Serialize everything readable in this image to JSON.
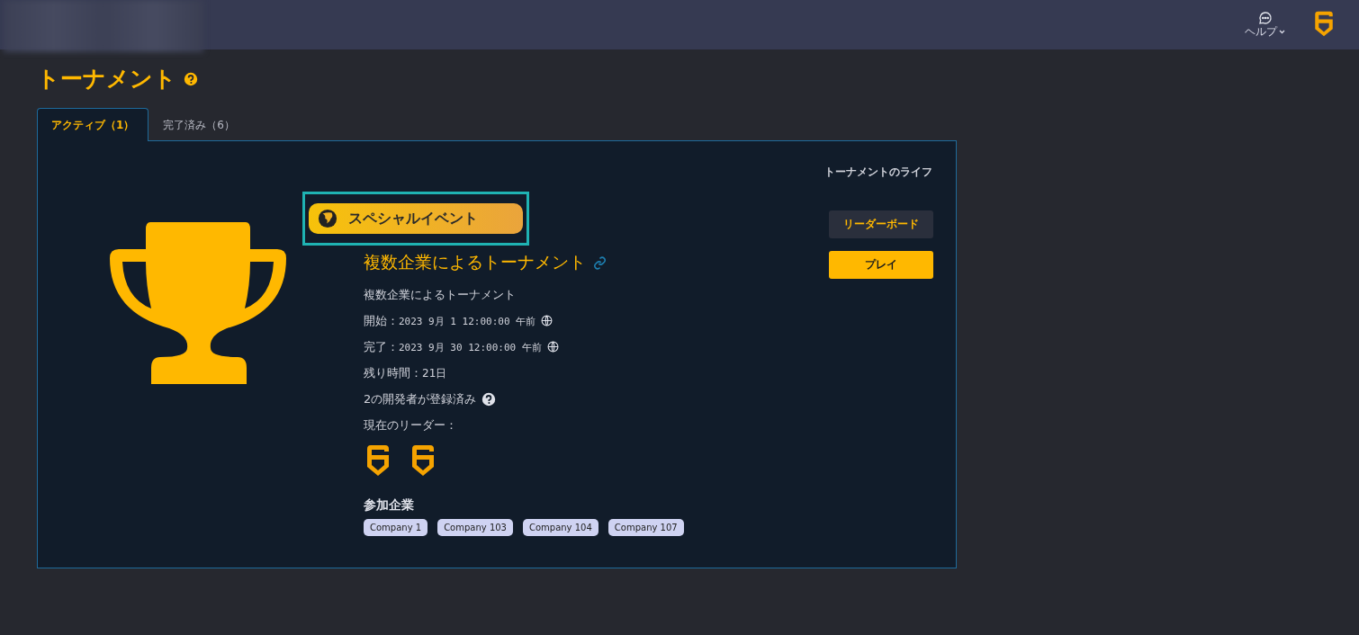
{
  "header": {
    "help_label": "ヘルプ"
  },
  "page_title": "トーナメント",
  "tabs": [
    {
      "label": "アクティブ（1）",
      "selected": true
    },
    {
      "label": "完了済み（6）",
      "selected": false
    }
  ],
  "tournament": {
    "badge": "スペシャルイベント",
    "title": "複数企業によるトーナメント",
    "description": "複数企業によるトーナメント",
    "details": [
      {
        "label": "開始：",
        "value": "2023 9月 1 12:00:00 午前",
        "kind": "date"
      },
      {
        "label": "完了：",
        "value": "2023 9月 30 12:00:00 午前",
        "kind": "date"
      },
      {
        "label": "残り時間：",
        "value": "21日",
        "kind": "plain"
      },
      {
        "label": "2の開発者が登録済み",
        "kind": "help"
      },
      {
        "label": "現在のリーダー：",
        "kind": "plain"
      }
    ],
    "companies_heading": "参加企業",
    "companies": [
      "Company 1",
      "Company 103",
      "Company 104",
      "Company 107"
    ],
    "life_label": "トーナメントのライフ",
    "buttons": [
      {
        "label": "リーダーボード",
        "kind": "secondary"
      },
      {
        "label": "プレイ",
        "kind": "primary"
      }
    ]
  }
}
